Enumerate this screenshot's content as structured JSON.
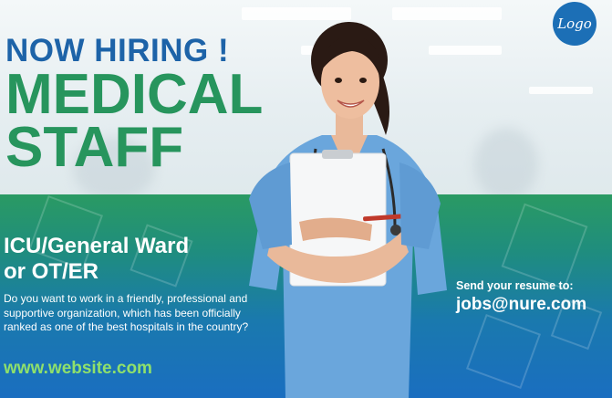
{
  "headline": {
    "line1": "NOW HIRING !",
    "line2": "MEDICAL",
    "line3": "STAFF"
  },
  "logo": {
    "label": "Logo"
  },
  "role": {
    "line1": "ICU/General Ward",
    "line2": "or OT/ER"
  },
  "description": "Do you want to work in a friendly, professional and supportive organization, which has been officially ranked as one of the best hospitals in the country?",
  "website": "www.website.com",
  "contact": {
    "label": "Send your resume to:",
    "email": "jobs@nure.com"
  },
  "colors": {
    "headline_blue": "#1d63a8",
    "headline_green": "#27955d",
    "band_top": "#2a9a63",
    "band_bottom": "#1a6ec0",
    "website_green": "#8fe06b",
    "scrubs": "#6aa6dc"
  }
}
